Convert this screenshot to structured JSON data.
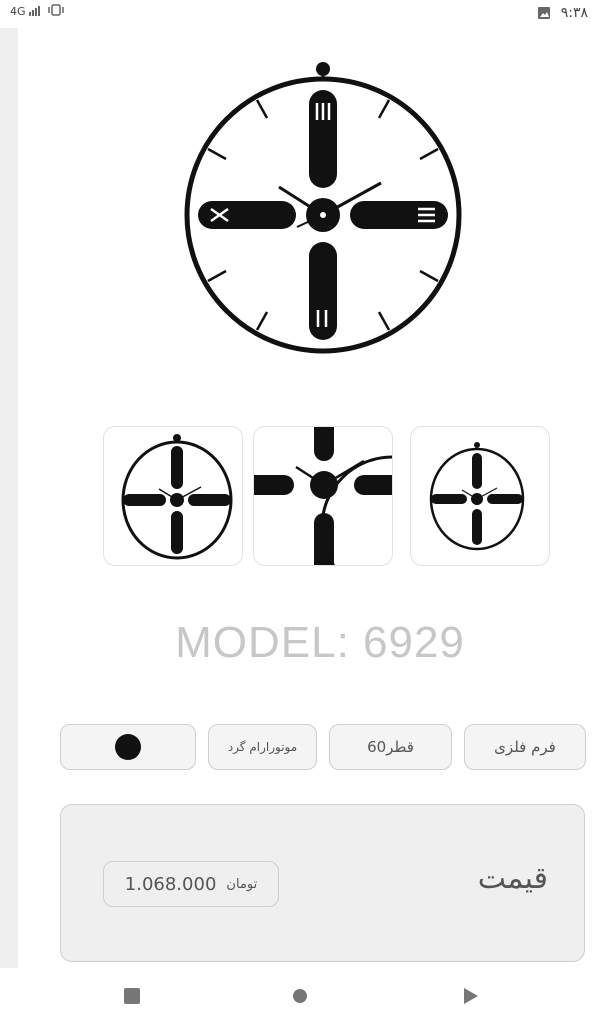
{
  "status_bar": {
    "time": "۹:۳۸",
    "network": "4G"
  },
  "product": {
    "model": "MODEL: 6929",
    "options": [
      {
        "label": "فرم فلزی"
      },
      {
        "label": "قطر60"
      },
      {
        "label": "موتورارام گرد"
      },
      {
        "label": "",
        "swatch_color": "#111111"
      }
    ]
  },
  "price": {
    "label": "قیمت",
    "value": "1.068.000",
    "currency": "تومان"
  },
  "colors": {
    "accent": "#111111",
    "panel": "#efefef"
  }
}
